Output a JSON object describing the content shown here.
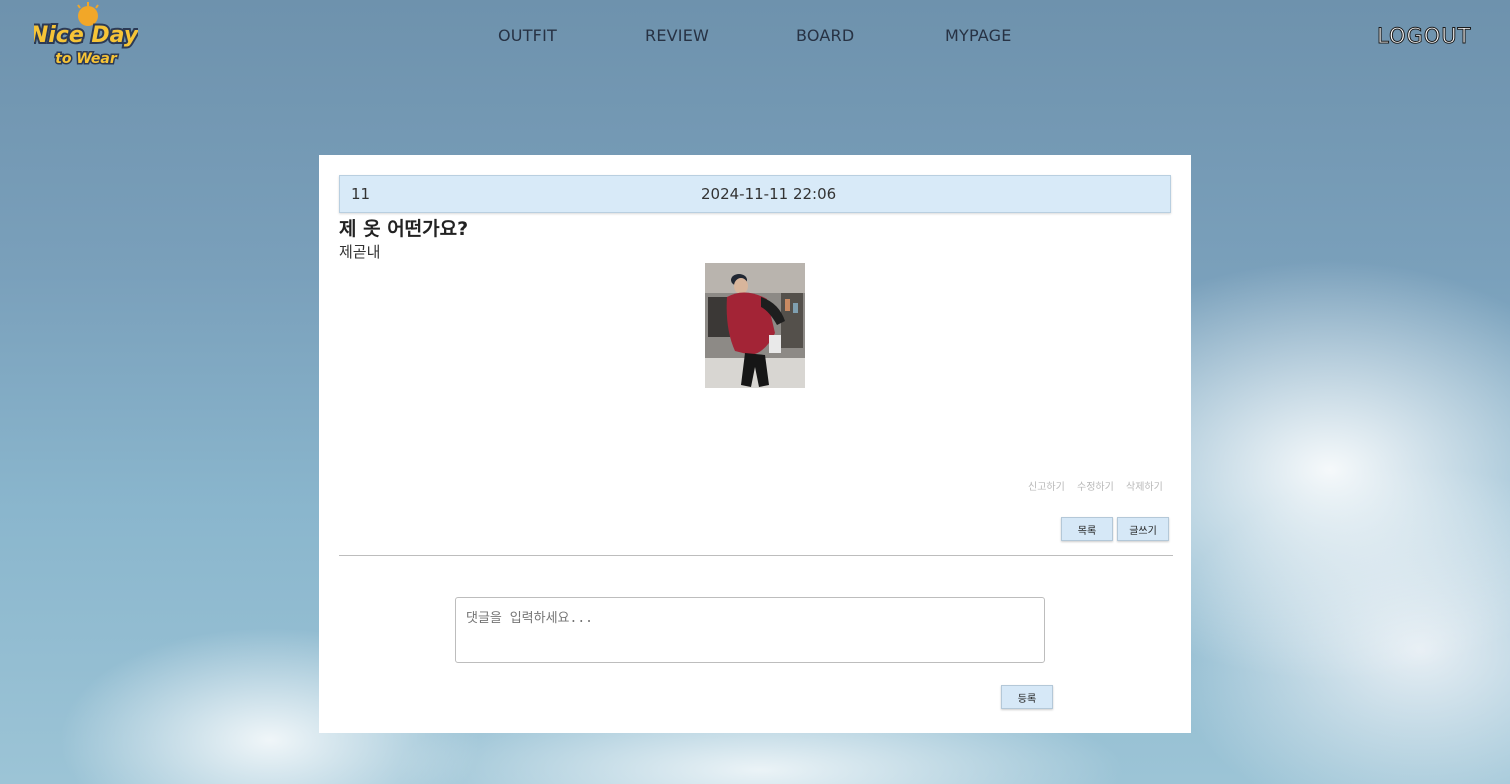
{
  "logo": {
    "line1": "Nice Day",
    "line2": "to Wear"
  },
  "nav": {
    "items": [
      {
        "label": "OUTFIT"
      },
      {
        "label": "REVIEW"
      },
      {
        "label": "BOARD"
      },
      {
        "label": "MYPAGE"
      }
    ],
    "logout_label": "LOGOUT"
  },
  "post": {
    "number": "11",
    "date": "2024-11-11 22:06",
    "title": "제 옷 어떤가요?",
    "author": "제곧내",
    "actions": {
      "report": "신고하기",
      "edit": "수정하기",
      "delete": "삭제하기"
    },
    "buttons": {
      "list": "목록",
      "write": "글쓰기"
    }
  },
  "comment": {
    "placeholder": "댓글을 입력하세요...",
    "submit_label": "등록"
  },
  "colors": {
    "header_bg": "#d8eaf8",
    "button_bg": "#d6e8f7",
    "logo_text": "#f6c437",
    "logo_outline": "#2c3a55"
  }
}
